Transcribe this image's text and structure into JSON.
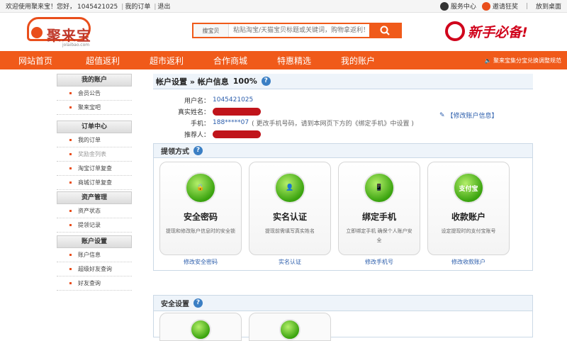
{
  "topbar": {
    "welcome": "欢迎使用聚来宝！您好，",
    "user_id": "1045421025",
    "my_orders": "我的订单",
    "logout": "退出",
    "service_center": "服务中心",
    "invite": "邀请狂奖",
    "desktop": "放到桌面"
  },
  "header": {
    "logo_text": "聚来宝",
    "logo_url": "jolaibao.com",
    "search_category": "搜宝贝",
    "search_placeholder": "粘贴淘宝/天猫宝贝标题或关键词，购物拿返利！",
    "newbie": "新手必备!"
  },
  "nav": {
    "items": [
      "网站首页",
      "超值返利",
      "超市返利",
      "合作商城",
      "特惠精选",
      "我的账户"
    ],
    "notice": "聚来宝集分宝兑换调整规范"
  },
  "sidebar": {
    "groups": [
      {
        "title": "我的账户",
        "items": [
          "会员公告",
          "聚来宝吧"
        ]
      },
      {
        "title": "订单中心",
        "items": [
          "我的订单",
          "奖励金列表",
          "淘宝订单复查",
          "商城订单复查"
        ]
      },
      {
        "title": "资产管理",
        "items": [
          "资产状态",
          "提领记录"
        ]
      },
      {
        "title": "账户设置",
        "items": [
          "账户信息",
          "超级好友查询",
          "好友查询"
        ]
      }
    ]
  },
  "main": {
    "title": "帐户设置 » 帐户信息",
    "percent": "100%",
    "edit_link": "【修改账户信息】",
    "fields": {
      "username_label": "用户名：",
      "username": "1045421025",
      "realname_label": "真实姓名：",
      "phone_label": "手机：",
      "phone": "188*****07",
      "phone_note": "( 更改手机号码，请到本网页下方的《绑定手机》中设置 )",
      "referrer_label": "推荐人："
    },
    "withdraw": {
      "title": "提领方式",
      "cards": [
        {
          "title": "安全密码",
          "desc": "提现和修改账户信息时的安全锁",
          "link": "修改安全密码",
          "icon": "lock-icon"
        },
        {
          "title": "实名认证",
          "desc": "提现前需填写真实姓名",
          "link": "实名认证",
          "icon": "user-icon"
        },
        {
          "title": "绑定手机",
          "desc": "立即绑定手机 确保个人账户安全",
          "link": "修改手机号",
          "icon": "phone-icon"
        },
        {
          "title": "收款账户",
          "desc": "设定提现时的支付宝账号",
          "link": "修改收款账户",
          "icon": "alipay-icon",
          "badge": "支付宝"
        }
      ]
    },
    "security_title": "安全设置"
  },
  "colors": {
    "accent": "#f05a1a",
    "link": "#2a5cab",
    "redact": "#c0141b"
  }
}
